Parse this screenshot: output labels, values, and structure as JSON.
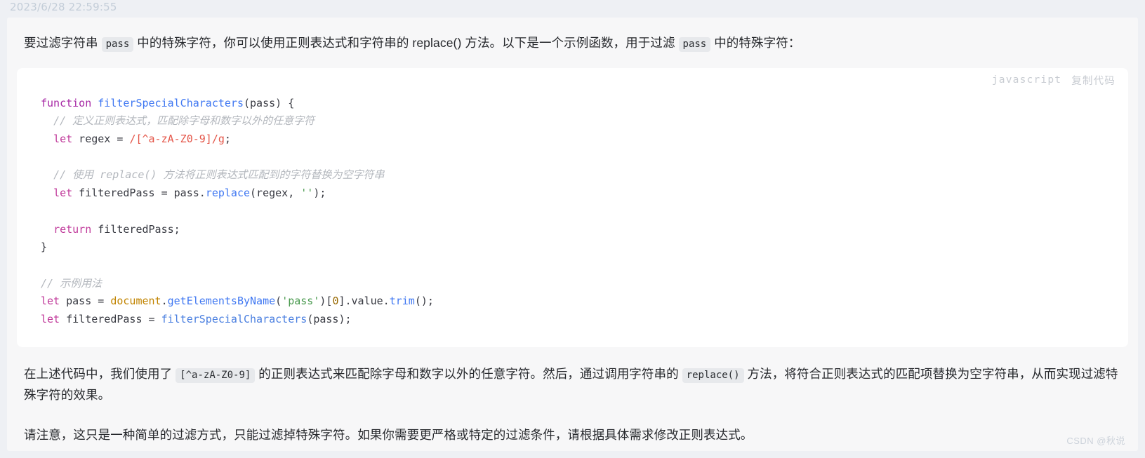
{
  "timestamp": "2023/6/28 22:59:55",
  "intro": {
    "seg1": "要过滤字符串",
    "code1": "pass",
    "seg2": "中的特殊字符，你可以使用正则表达式和字符串的 replace() 方法。以下是一个示例函数，用于过滤",
    "code2": "pass",
    "seg3": "中的特殊字符："
  },
  "code_block": {
    "language": "javascript",
    "copy_label": "复制代码",
    "lines": [
      {
        "tokens": [
          {
            "t": "function",
            "c": "kw"
          },
          {
            "t": " ",
            "c": "plain"
          },
          {
            "t": "filterSpecialCharacters",
            "c": "fn"
          },
          {
            "t": "(pass) {",
            "c": "punct"
          }
        ]
      },
      {
        "indent": 1,
        "tokens": [
          {
            "t": "// 定义正则表达式，匹配除字母和数字以外的任意字符",
            "c": "cmt"
          }
        ]
      },
      {
        "indent": 1,
        "tokens": [
          {
            "t": "let",
            "c": "kw2"
          },
          {
            "t": " regex = ",
            "c": "plain"
          },
          {
            "t": "/[^a-zA-Z0-9]/g",
            "c": "re"
          },
          {
            "t": ";",
            "c": "punct"
          }
        ]
      },
      {
        "tokens": []
      },
      {
        "indent": 1,
        "tokens": [
          {
            "t": "// 使用 replace() 方法将正则表达式匹配到的字符替换为空字符串",
            "c": "cmt"
          }
        ]
      },
      {
        "indent": 1,
        "tokens": [
          {
            "t": "let",
            "c": "kw2"
          },
          {
            "t": " filteredPass = pass.",
            "c": "plain"
          },
          {
            "t": "replace",
            "c": "fn"
          },
          {
            "t": "(regex, ",
            "c": "punct"
          },
          {
            "t": "''",
            "c": "str"
          },
          {
            "t": ");",
            "c": "punct"
          }
        ]
      },
      {
        "tokens": []
      },
      {
        "indent": 1,
        "tokens": [
          {
            "t": "return",
            "c": "kw2"
          },
          {
            "t": " filteredPass;",
            "c": "plain"
          }
        ]
      },
      {
        "tokens": [
          {
            "t": "}",
            "c": "punct"
          }
        ]
      },
      {
        "tokens": []
      },
      {
        "tokens": [
          {
            "t": "// 示例用法",
            "c": "cmt"
          }
        ]
      },
      {
        "tokens": [
          {
            "t": "let",
            "c": "kw2"
          },
          {
            "t": " pass = ",
            "c": "plain"
          },
          {
            "t": "document",
            "c": "var"
          },
          {
            "t": ".",
            "c": "punct"
          },
          {
            "t": "getElementsByName",
            "c": "fn"
          },
          {
            "t": "(",
            "c": "punct"
          },
          {
            "t": "'pass'",
            "c": "str"
          },
          {
            "t": ")[",
            "c": "punct"
          },
          {
            "t": "0",
            "c": "num"
          },
          {
            "t": "].value.",
            "c": "punct"
          },
          {
            "t": "trim",
            "c": "fn"
          },
          {
            "t": "();",
            "c": "punct"
          }
        ]
      },
      {
        "tokens": [
          {
            "t": "let",
            "c": "kw2"
          },
          {
            "t": " filteredPass = ",
            "c": "plain"
          },
          {
            "t": "filterSpecialCharacters",
            "c": "fn2"
          },
          {
            "t": "(pass);",
            "c": "punct"
          }
        ]
      }
    ]
  },
  "after_code": {
    "seg1": "在上述代码中，我们使用了",
    "code1": "[^a-zA-Z0-9]",
    "seg2": "的正则表达式来匹配除字母和数字以外的任意字符。然后，通过调用字符串的",
    "code2": "replace()",
    "seg3": "方法，将符合正则表达式的匹配项替换为空字符串，从而实现过滤特殊字符的效果。"
  },
  "note": "请注意，这只是一种简单的过滤方式，只能过滤掉特殊字符。如果你需要更严格或特定的过滤条件，请根据具体需求修改正则表达式。",
  "watermark": "CSDN @秋说"
}
